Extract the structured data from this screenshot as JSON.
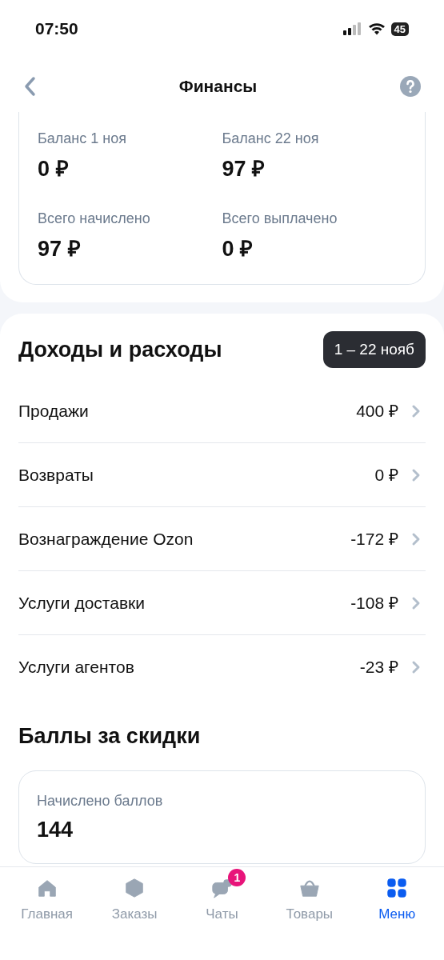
{
  "status_bar": {
    "time": "07:50",
    "battery": "45"
  },
  "header": {
    "title": "Финансы"
  },
  "balance": [
    {
      "label": "Баланс 1 ноя",
      "value": "0 ₽"
    },
    {
      "label": "Баланс 22 ноя",
      "value": "97 ₽"
    },
    {
      "label": "Всего начислено",
      "value": "97 ₽"
    },
    {
      "label": "Всего выплачено",
      "value": "0 ₽"
    }
  ],
  "income": {
    "title": "Доходы и расходы",
    "period": "1 – 22 нояб",
    "rows": [
      {
        "label": "Продажи",
        "value": "400 ₽"
      },
      {
        "label": "Возвраты",
        "value": "0 ₽"
      },
      {
        "label": "Вознаграждение Ozon",
        "value": "-172 ₽"
      },
      {
        "label": "Услуги доставки",
        "value": "-108 ₽"
      },
      {
        "label": "Услуги агентов",
        "value": "-23 ₽"
      }
    ]
  },
  "points": {
    "title": "Баллы за скидки",
    "label": "Начислено баллов",
    "value": "144"
  },
  "tab_bar": [
    {
      "kind": "home",
      "label": "Главная",
      "selected": false
    },
    {
      "kind": "orders",
      "label": "Заказы",
      "selected": false
    },
    {
      "kind": "chats",
      "label": "Чаты",
      "selected": false,
      "badge": "1"
    },
    {
      "kind": "goods",
      "label": "Товары",
      "selected": false
    },
    {
      "kind": "menu",
      "label": "Меню",
      "selected": true
    }
  ]
}
